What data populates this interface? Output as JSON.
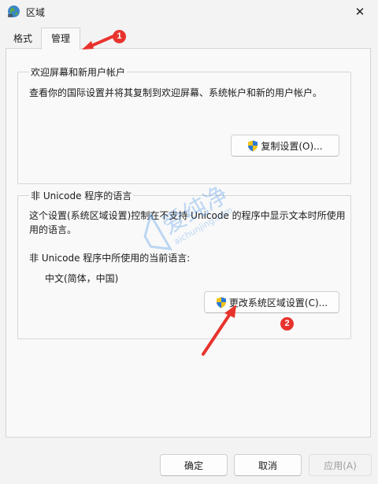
{
  "window": {
    "title": "区域",
    "close_glyph": "✕"
  },
  "tabs": [
    {
      "label": "格式",
      "selected": false
    },
    {
      "label": "管理",
      "selected": true
    }
  ],
  "welcome_group": {
    "title": "欢迎屏幕和新用户帐户",
    "description": "查看你的国际设置并将其复制到欢迎屏幕、系统帐户和新的用户帐户。",
    "copy_button": "复制设置(O)..."
  },
  "unicode_group": {
    "title": "非 Unicode 程序的语言",
    "description_line1": "这个设置(系统区域设置)控制在不支持 Unicode 的程序中显示文本时所使用",
    "description_line2": "用的语言。",
    "current_label": "非 Unicode 程序中所使用的当前语言:",
    "current_value": "中文(简体，中国)",
    "change_button": "更改系统区域设置(C)..."
  },
  "footer": {
    "ok": "确定",
    "cancel": "取消",
    "apply": "应用(A)"
  },
  "annotations": {
    "badge1": "1",
    "badge2": "2",
    "color": "#e8332d"
  },
  "watermark": {
    "main": "爱纯净",
    "sub": "aichunjing.com"
  }
}
